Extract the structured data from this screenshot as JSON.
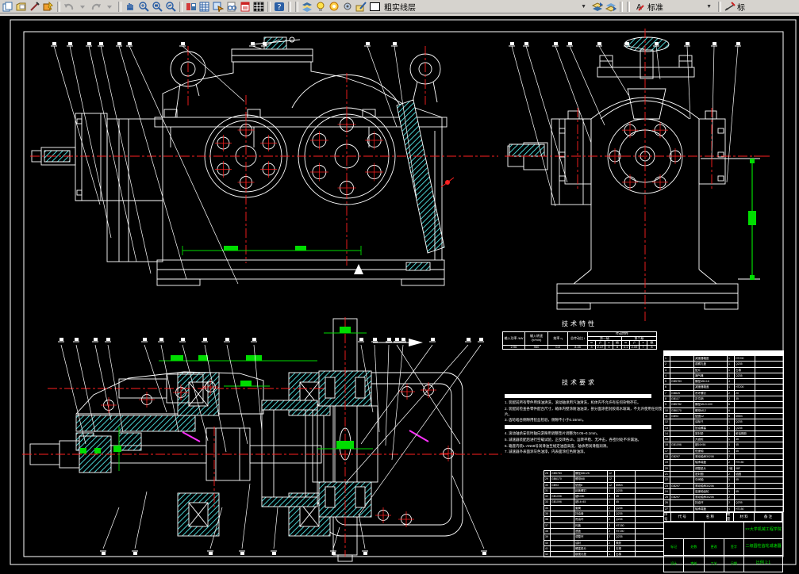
{
  "toolbar": {
    "layer_combo": "粗实线层",
    "style_combo": "标准",
    "trailing_label": "标",
    "icons": [
      "new",
      "open",
      "format-brush",
      "edit-properties",
      "undo",
      "redo",
      "pan",
      "zoom-in",
      "zoom-window",
      "zoom-previous",
      "refresh-view",
      "grid-display",
      "window-arrow",
      "print-preview",
      "macro-book",
      "table-grid",
      "help",
      "layers",
      "visibility-bulb",
      "color-circle",
      "layer-gear",
      "layer-pen",
      "color-swatch",
      "layer-up",
      "layer-down",
      "text-style",
      "dimension-style"
    ]
  },
  "drawing": {
    "tech_table": {
      "title": "技术特性",
      "col_headers": [
        "输入功率 /kW",
        "输入转速 /(r/min)",
        "效率 η",
        "总传动比 i"
      ],
      "trans_header": "传动特性",
      "stage_headers": [
        "第一级",
        "第二级"
      ],
      "sub_headers": [
        "m",
        "β",
        "z",
        "级"
      ],
      "values": [
        "2.96",
        "960",
        "0.8",
        "8.35"
      ],
      "stage1": [
        "3",
        "2.47",
        "9",
        "8"
      ],
      "stage2": [
        "4.1",
        "2.09",
        "7",
        "8"
      ]
    },
    "tech_req_title": "技术要求",
    "tech_notes": [
      {
        "type": "bar",
        "text": ""
      },
      {
        "type": "text",
        "text": "1. 装配前所有零件用煤油清洗，滚动轴承用汽油清洗，机体内不允许有任何杂物存在。"
      },
      {
        "type": "text",
        "text": "2. 装配前检查各零件配合尺寸，箱体内壁涂耐油油漆，剖分面涂密封胶或水玻璃，不允许使用任何垫片。"
      },
      {
        "type": "text",
        "text": "3. 齿轮啮合侧隙用铅丝检验，侧隙不小于0.16mm。"
      },
      {
        "type": "bar",
        "text": ""
      },
      {
        "type": "text",
        "text": "4. 滚动轴承安装时轴向游隙用调整垫片调整为0.05~0.1mm。"
      },
      {
        "type": "text",
        "text": "5. 减速器装配后进行空载试验，正反转各1h，运转平稳、无冲击，各密封处不许漏油。"
      },
      {
        "type": "text",
        "text": "6. 箱座内装L-AN68号润滑油至规定油面高度，轴承用润滑脂润滑。"
      },
      {
        "type": "text",
        "text": "7. 减速器外表面涂灰色油漆，内表面涂红色耐油漆。"
      }
    ],
    "bom_header": [
      "序号",
      "代 号",
      "名 称",
      "数量",
      "材 料",
      "备 注"
    ],
    "bom_rows": [
      [
        "1",
        "",
        "减速器箱座",
        "1",
        "HT200",
        ""
      ],
      [
        "2",
        "",
        "观察孔盖",
        "1",
        "Q235",
        ""
      ],
      [
        "3",
        "",
        "垫片",
        "1",
        "石棉",
        ""
      ],
      [
        "4",
        "",
        "通气器",
        "1",
        "Q235",
        ""
      ],
      [
        "5",
        "GB5783",
        "螺栓M6×16",
        "4",
        "",
        ""
      ],
      [
        "6",
        "",
        "减速器箱盖",
        "1",
        "HT200",
        ""
      ],
      [
        "7",
        "GB825",
        "吊环螺钉",
        "2",
        "20",
        ""
      ],
      [
        "8",
        "GB117",
        "定位销",
        "2",
        "35",
        ""
      ],
      [
        "9",
        "GB5782",
        "螺栓M12×100",
        "6",
        "",
        ""
      ],
      [
        "10",
        "GB6170",
        "螺母M12",
        "6",
        "",
        ""
      ],
      [
        "11",
        "GB93",
        "垫圈12",
        "6",
        "65Mn",
        ""
      ],
      [
        "12",
        "",
        "油标尺",
        "1",
        "Q235",
        ""
      ],
      [
        "13",
        "",
        "放油螺塞",
        "1",
        "Q235",
        ""
      ],
      [
        "14",
        "",
        "密封垫",
        "1",
        "耐油橡胶",
        ""
      ],
      [
        "15",
        "",
        "大齿轮",
        "1",
        "45",
        ""
      ],
      [
        "16",
        "GB1096",
        "键16×56",
        "1",
        "45",
        ""
      ],
      [
        "17",
        "",
        "低速轴",
        "1",
        "45",
        ""
      ],
      [
        "18",
        "GB297",
        "滚动轴承30208",
        "2",
        "",
        ""
      ],
      [
        "19",
        "",
        "轴承端盖",
        "2",
        "HT150",
        ""
      ],
      [
        "20",
        "",
        "调整垫片",
        "2组",
        "08F",
        ""
      ],
      [
        "21",
        "",
        "密封圈",
        "2",
        "毡圈",
        ""
      ],
      [
        "22",
        "",
        "中间轴",
        "1",
        "45",
        ""
      ],
      [
        "23",
        "GB297",
        "滚动轴承30206",
        "2",
        "",
        ""
      ],
      [
        "24",
        "",
        "高速轴齿轮",
        "1",
        "45",
        ""
      ],
      [
        "25",
        "GB297",
        "滚动轴承30205",
        "2",
        "",
        ""
      ],
      [
        "26",
        "",
        "挡油环",
        "2",
        "Q235",
        ""
      ],
      [
        "27",
        "",
        "轴承端盖",
        "4",
        "HT150",
        ""
      ],
      [
        "28",
        "GB5783",
        "螺栓M8×25",
        "12",
        "",
        ""
      ],
      [
        "29",
        "GB6170",
        "螺母M8",
        "12",
        "",
        ""
      ],
      [
        "30",
        "GB93",
        "垫圈8",
        "12",
        "65Mn",
        ""
      ],
      [
        "31",
        "",
        "起盖螺钉",
        "1",
        "Q235",
        ""
      ],
      [
        "32",
        "GB1096",
        "键8×50",
        "1",
        "45",
        ""
      ],
      [
        "33",
        "GB1096",
        "键14×45",
        "1",
        "45",
        ""
      ],
      [
        "34",
        "",
        "套筒",
        "2",
        "Q235",
        ""
      ],
      [
        "35",
        "",
        "挡油盘",
        "2",
        "Q235",
        ""
      ],
      [
        "36",
        "",
        "甩油环",
        "2",
        "Q235",
        ""
      ],
      [
        "37",
        "",
        "闷盖",
        "2",
        "HT150",
        ""
      ],
      [
        "38",
        "",
        "透盖",
        "2",
        "HT150",
        ""
      ],
      [
        "39",
        "",
        "调整环",
        "2",
        "Q235",
        ""
      ],
      [
        "40",
        "",
        "油封",
        "2",
        "橡胶",
        ""
      ],
      [
        "41",
        "",
        "螺塞垫片",
        "1",
        "石棉",
        ""
      ],
      [
        "42",
        "",
        "窥视孔垫",
        "1",
        "石棉",
        ""
      ]
    ],
    "title_block": {
      "school": "××大学机械工程学院",
      "title": "二级圆柱齿轮减速器",
      "scale": "比例 1:1",
      "cells_row2": [
        "标记",
        "处数",
        "更改",
        "签字"
      ],
      "cells_row3": [
        "设计",
        "审核",
        "工艺",
        "日期"
      ]
    }
  }
}
